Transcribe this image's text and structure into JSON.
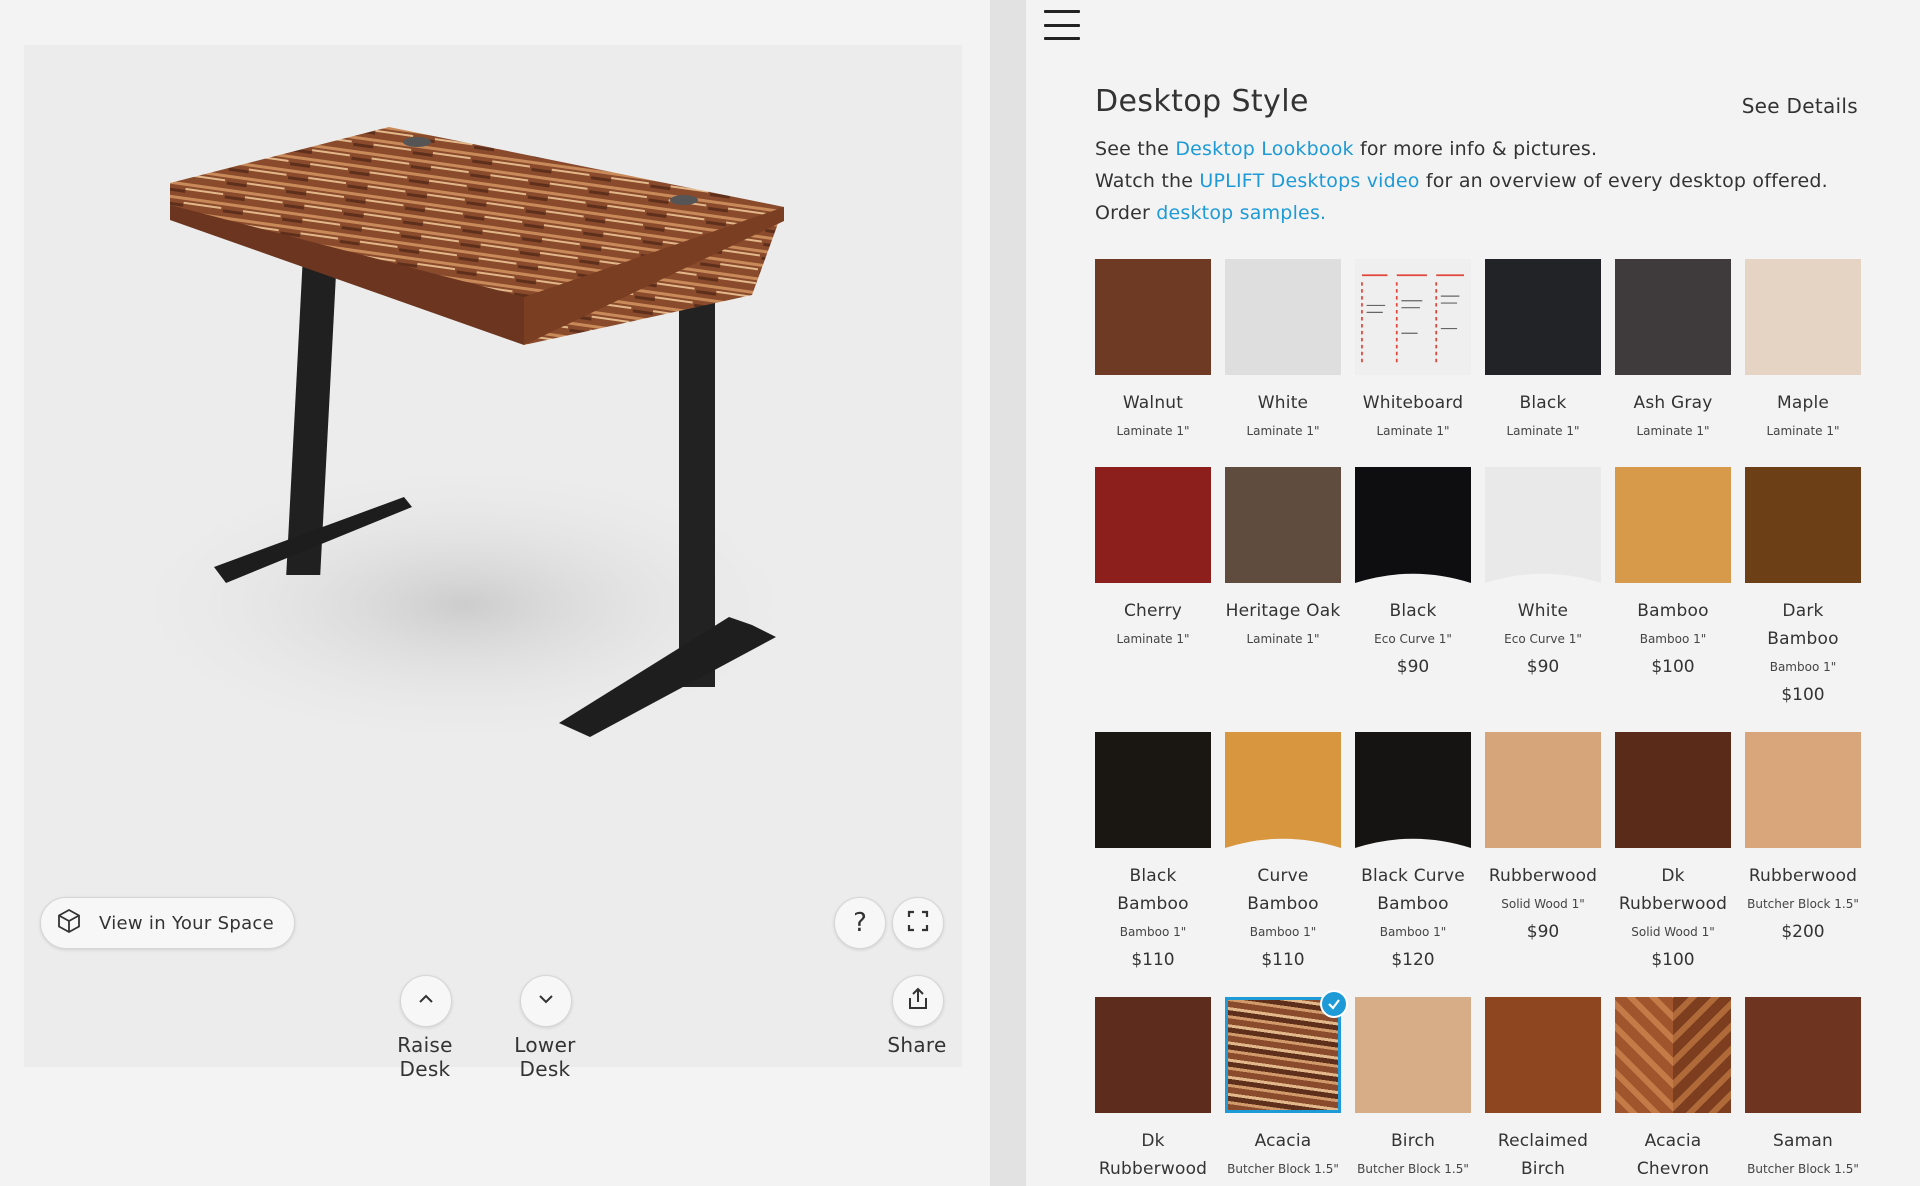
{
  "viewer": {
    "view_in_space_label": "View in Your Space",
    "raise_label": "Raise Desk",
    "lower_label": "Lower Desk",
    "share_label": "Share",
    "help_symbol": "?"
  },
  "panel": {
    "title": "Desktop Style",
    "see_details": "See Details",
    "lines": [
      {
        "pre": "See the ",
        "link": "Desktop Lookbook",
        "post": " for more info & pictures."
      },
      {
        "pre": "Watch the ",
        "link": "UPLIFT Desktops video",
        "post": " for an overview of every desktop offered."
      },
      {
        "pre": "Order ",
        "link": "desktop samples.",
        "post": ""
      }
    ]
  },
  "colors": {
    "accent": "#1e9ad6",
    "frame": "#222222"
  },
  "swatches": [
    [
      {
        "name": "Walnut",
        "material": "Laminate 1\"",
        "price": "",
        "color": "#6e3a24"
      },
      {
        "name": "White",
        "material": "Laminate 1\"",
        "price": "",
        "color": "#dedede"
      },
      {
        "name": "Whiteboard",
        "material": "Laminate 1\"",
        "price": "",
        "color": "#efefef",
        "pattern": "whiteboard"
      },
      {
        "name": "Black",
        "material": "Laminate 1\"",
        "price": "",
        "color": "#222326"
      },
      {
        "name": "Ash Gray",
        "material": "Laminate 1\"",
        "price": "",
        "color": "#3f3b3c"
      },
      {
        "name": "Maple",
        "material": "Laminate 1\"",
        "price": "",
        "color": "#e5d3c3"
      }
    ],
    [
      {
        "name": "Cherry",
        "material": "Laminate 1\"",
        "price": "",
        "color": "#8c1f1c"
      },
      {
        "name": "Heritage Oak",
        "material": "Laminate 1\"",
        "price": "",
        "color": "#5f4c3f"
      },
      {
        "name": "Black",
        "material": "Eco Curve 1\"",
        "price": "$90",
        "color": "#0e0e10",
        "pattern": "curve"
      },
      {
        "name": "White",
        "material": "Eco Curve 1\"",
        "price": "$90",
        "color": "#e9e9e9",
        "pattern": "curve"
      },
      {
        "name": "Bamboo",
        "material": "Bamboo 1\"",
        "price": "$100",
        "color": "#d79a4a"
      },
      {
        "name": "Dark Bamboo",
        "material": "Bamboo 1\"",
        "price": "$100",
        "color": "#6d3f16"
      }
    ],
    [
      {
        "name": "Black Bamboo",
        "material": "Bamboo 1\"",
        "price": "$110",
        "color": "#1a1612"
      },
      {
        "name": "Curve Bamboo",
        "material": "Bamboo 1\"",
        "price": "$110",
        "color": "#d8973f",
        "pattern": "curve"
      },
      {
        "name": "Black Curve Bamboo",
        "material": "Bamboo 1\"",
        "price": "$120",
        "color": "#161412",
        "pattern": "curve"
      },
      {
        "name": "Rubberwood",
        "material": "Solid Wood 1\"",
        "price": "$90",
        "color": "#d6a57a"
      },
      {
        "name": "Dk Rubberwood",
        "material": "Solid Wood 1\"",
        "price": "$100",
        "color": "#5b2b1a"
      },
      {
        "name": "Rubberwood",
        "material": "Butcher Block 1.5\"",
        "price": "$200",
        "color": "#d9a67b"
      }
    ],
    [
      {
        "name": "Dk Rubberwood",
        "material": "",
        "price": "",
        "color": "#5e2c1d"
      },
      {
        "name": "Acacia",
        "material": "Butcher Block 1.5\"",
        "price": "",
        "color": "#8a4a2c",
        "pattern": "stripes",
        "selected": true
      },
      {
        "name": "Birch",
        "material": "Butcher Block 1.5\"",
        "price": "",
        "color": "#d6ad86"
      },
      {
        "name": "Reclaimed Birch",
        "material": "",
        "price": "",
        "color": "#8e4620"
      },
      {
        "name": "Acacia Chevron",
        "material": "",
        "price": "",
        "color": "#a0552d",
        "pattern": "chevron"
      },
      {
        "name": "Saman",
        "material": "Butcher Block 1.5\"",
        "price": "",
        "color": "#6e3420"
      }
    ]
  ]
}
